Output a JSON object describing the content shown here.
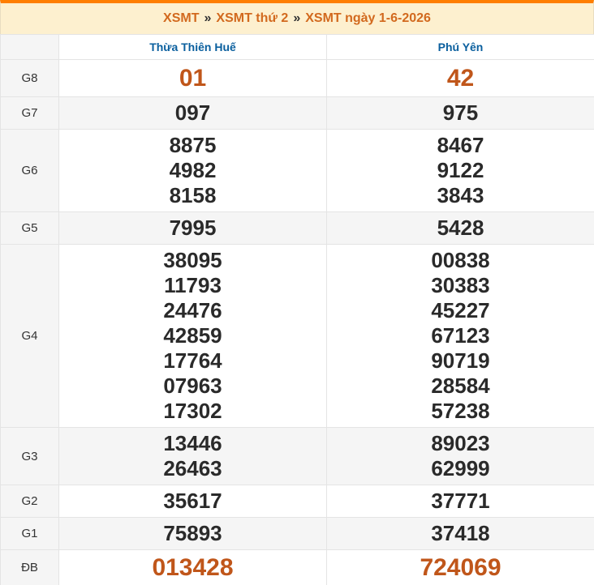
{
  "breadcrumb": {
    "items": [
      "XSMT",
      "XSMT thứ 2",
      "XSMT ngày 1-6-2026"
    ],
    "separator": "»"
  },
  "table": {
    "provinces": [
      "Thừa Thiên Huế",
      "Phú Yên"
    ],
    "rows": [
      {
        "label": "G8",
        "p1": [
          "01"
        ],
        "p2": [
          "42"
        ]
      },
      {
        "label": "G7",
        "p1": [
          "097"
        ],
        "p2": [
          "975"
        ]
      },
      {
        "label": "G6",
        "p1": [
          "8875",
          "4982",
          "8158"
        ],
        "p2": [
          "8467",
          "9122",
          "3843"
        ]
      },
      {
        "label": "G5",
        "p1": [
          "7995"
        ],
        "p2": [
          "5428"
        ]
      },
      {
        "label": "G4",
        "p1": [
          "38095",
          "11793",
          "24476",
          "42859",
          "17764",
          "07963",
          "17302"
        ],
        "p2": [
          "00838",
          "30383",
          "45227",
          "67123",
          "90719",
          "28584",
          "57238"
        ]
      },
      {
        "label": "G3",
        "p1": [
          "13446",
          "26463"
        ],
        "p2": [
          "89023",
          "62999"
        ]
      },
      {
        "label": "G2",
        "p1": [
          "35617"
        ],
        "p2": [
          "37771"
        ]
      },
      {
        "label": "G1",
        "p1": [
          "75893"
        ],
        "p2": [
          "37418"
        ]
      },
      {
        "label": "ĐB",
        "p1": [
          "013428"
        ],
        "p2": [
          "724069"
        ]
      }
    ]
  },
  "colors": {
    "accent_orange": "#ff7e00",
    "title_bg": "#fdf0cf",
    "title_text": "#d2691e",
    "province_header": "#0a5f9e",
    "highlight_number": "#c0561a",
    "row_shade": "#f5f5f5"
  }
}
